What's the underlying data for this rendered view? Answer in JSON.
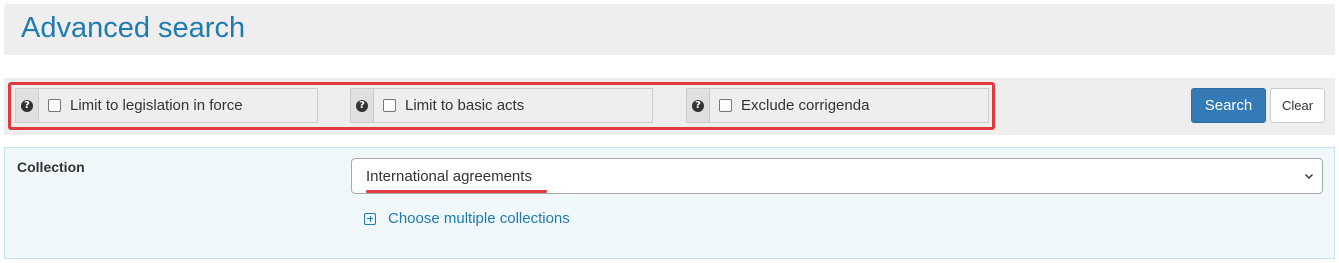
{
  "header": {
    "title": "Advanced search"
  },
  "options": [
    {
      "label": "Limit to legislation in force",
      "checked": false,
      "icon": "question-circle-icon"
    },
    {
      "label": "Limit to basic acts",
      "checked": false,
      "icon": "question-circle-icon"
    },
    {
      "label": "Exclude corrigenda",
      "checked": false,
      "icon": "question-circle-icon"
    }
  ],
  "help_glyph": "?",
  "buttons": {
    "search": "Search",
    "clear": "Clear"
  },
  "collection": {
    "label": "Collection",
    "selected": "International agreements",
    "multi_link": "Choose multiple collections"
  },
  "colors": {
    "title": "#1f7bb0",
    "primary_button": "#337ab7",
    "highlight": "#e0393e",
    "panel_bg": "#f0f8fc"
  }
}
